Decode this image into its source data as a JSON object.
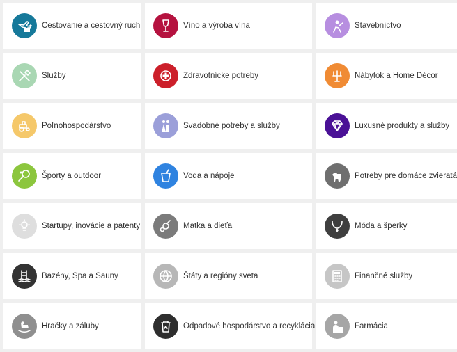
{
  "categories": [
    {
      "label": "Cestovanie a cestovný ruch",
      "icon": "airplane-luggage-icon",
      "color": "#16799a"
    },
    {
      "label": "Víno a výroba vína",
      "icon": "wine-glass-icon",
      "color": "#b5123f"
    },
    {
      "label": "Stavebníctvo",
      "icon": "construction-worker-icon",
      "color": "#b78ee0"
    },
    {
      "label": "Služby",
      "icon": "tools-icon",
      "color": "#a9d7b3"
    },
    {
      "label": "Zdravotnícke potreby",
      "icon": "medical-cross-icon",
      "color": "#cc1f2a"
    },
    {
      "label": "Nábytok a Home Décor",
      "icon": "candelabra-icon",
      "color": "#f08b34"
    },
    {
      "label": "Poľnohospodárstvo",
      "icon": "tractor-icon",
      "color": "#f5c86a"
    },
    {
      "label": "Svadobné potreby a služby",
      "icon": "wedding-couple-icon",
      "color": "#9b9fd9"
    },
    {
      "label": "Luxusné produkty a služby",
      "icon": "diamond-icon",
      "color": "#4a1196"
    },
    {
      "label": "Športy a outdoor",
      "icon": "tennis-racket-icon",
      "color": "#8cc63e"
    },
    {
      "label": "Voda a nápoje",
      "icon": "drink-cup-icon",
      "color": "#2f83e0"
    },
    {
      "label": "Potreby pre domáce zvieratá",
      "icon": "dog-icon",
      "color": "#6f6f6f"
    },
    {
      "label": "Startupy, inovácie a patenty",
      "icon": "lightbulb-icon",
      "color": "#dedede"
    },
    {
      "label": "Matka a dieťa",
      "icon": "pacifier-icon",
      "color": "#7b7b7b"
    },
    {
      "label": "Móda a šperky",
      "icon": "necklace-icon",
      "color": "#3f3f3f"
    },
    {
      "label": "Bazény, Spa a Sauny",
      "icon": "pool-ladder-icon",
      "color": "#333333"
    },
    {
      "label": "Štáty a regióny sveta",
      "icon": "globe-icon",
      "color": "#b7b7b7"
    },
    {
      "label": "Finančné služby",
      "icon": "calculator-icon",
      "color": "#c6c6c6"
    },
    {
      "label": "Hračky a záluby",
      "icon": "rocking-horse-icon",
      "color": "#8f8f8f"
    },
    {
      "label": "Odpadové hospodárstvo a recyklácia",
      "icon": "recycle-bin-icon",
      "color": "#2e2e2e"
    },
    {
      "label": "Farmácia",
      "icon": "pharmacist-icon",
      "color": "#a6a6a6"
    }
  ]
}
